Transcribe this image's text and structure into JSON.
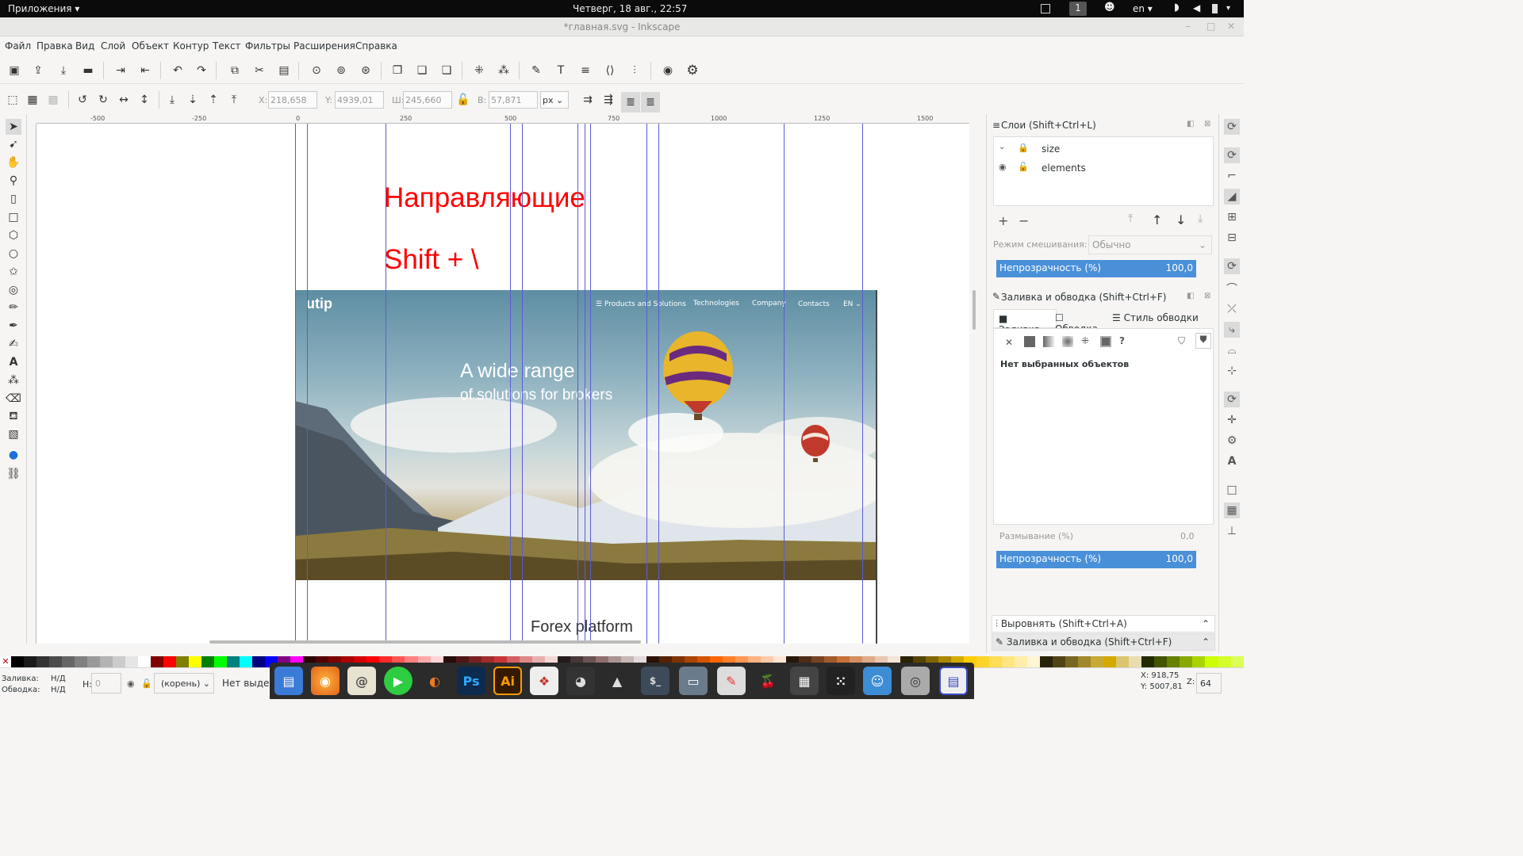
{
  "topbar": {
    "apps_menu": "Приложения ▾",
    "clock": "Четверг, 18 авг., 22:57",
    "workspace": "1",
    "lang": "en ▾"
  },
  "window": {
    "title": "*главная.svg - Inkscape"
  },
  "menu": [
    "Файл",
    "Правка",
    "Вид",
    "Слой",
    "Объект",
    "Контур",
    "Текст",
    "Фильтры",
    "Расширения",
    "Справка"
  ],
  "toolcontrols": {
    "x_label": "X:",
    "x_value": "218,658",
    "y_label": "Y:",
    "y_value": "4939,01",
    "w_label": "Ш:",
    "w_value": "245,660",
    "h_label": "В:",
    "h_value": "57,871",
    "unit": "px"
  },
  "ruler": {
    "ticks": [
      "-500",
      "-250",
      "0",
      "250",
      "500",
      "750",
      "1000",
      "1250",
      "1500"
    ]
  },
  "canvas": {
    "heading": "Направляющие",
    "shortcut": "Shift + \\",
    "hero": {
      "logo": "utip",
      "nav": [
        "☰ Products and Solutions",
        "Technologies",
        "Company",
        "Contacts",
        "EN ⌄"
      ],
      "headline": "A wide range",
      "subline": "of solutions for brokers"
    },
    "below": "Forex platform"
  },
  "layers_panel": {
    "title": "Слои (Shift+Ctrl+L)",
    "layers": [
      {
        "name": "size"
      },
      {
        "name": "elements"
      }
    ],
    "blend_label": "Режим смешивания:",
    "blend_value": "Обычно",
    "opacity_label": "Непрозрачность (%)",
    "opacity_value": "100,0"
  },
  "fill_panel": {
    "title": "Заливка и обводка (Shift+Ctrl+F)",
    "tabs": [
      "Заливка",
      "Обводка",
      "Стиль обводки"
    ],
    "empty": "Нет выбранных объектов",
    "blur_label": "Размывание (%)",
    "blur_value": "0,0",
    "opacity_label": "Непрозрачность (%)",
    "opacity_value": "100,0"
  },
  "collapsed_panels": [
    "Выровнять (Shift+Ctrl+A)",
    "Заливка и обводка (Shift+Ctrl+F)"
  ],
  "status": {
    "fill_label": "Заливка:",
    "fill_value": "Н/Д",
    "stroke_label": "Обводка:",
    "stroke_value": "Н/Д",
    "h_label": "Н:",
    "h_value": "0",
    "layer": "(корень)",
    "message": "Нет выделе",
    "x": "X:  918,75",
    "y": "Y: 5007,81",
    "zoom_label": "Z:",
    "zoom": "64"
  },
  "palette": [
    "#000000",
    "#1a1a1a",
    "#333333",
    "#4d4d4d",
    "#666666",
    "#808080",
    "#999999",
    "#b3b3b3",
    "#cccccc",
    "#e6e6e6",
    "#ffffff",
    "#800000",
    "#ff0000",
    "#808000",
    "#ffff00",
    "#008000",
    "#00ff00",
    "#008080",
    "#00ffff",
    "#000080",
    "#0000ff",
    "#800080",
    "#ff00ff",
    "#2b0000",
    "#550000",
    "#800000",
    "#aa0000",
    "#d40000",
    "#ff0000",
    "#ff2a2a",
    "#ff5555",
    "#ff8080",
    "#ffaaaa",
    "#ffd5d5",
    "#280b0b",
    "#501616",
    "#782121",
    "#a02c2c",
    "#c83737",
    "#d35f5f",
    "#de8787",
    "#e9afaf",
    "#f4d7d7",
    "#241c1c",
    "#483737",
    "#6c5353",
    "#916f6f",
    "#ac9393",
    "#c8b7b7",
    "#e3dbdb",
    "#2b1100",
    "#552200",
    "#803300",
    "#aa4400",
    "#d45500",
    "#ff6600",
    "#ff7f2a",
    "#ff9955",
    "#ffb380",
    "#ffccaa",
    "#ffe6d5",
    "#28170b",
    "#502d16",
    "#784421",
    "#a05a2c",
    "#c87137",
    "#d38d5f",
    "#deaa87",
    "#e9c6af",
    "#f4e3d7",
    "#2b2200",
    "#554400",
    "#806600",
    "#aa8800",
    "#d4aa00",
    "#ffcc00",
    "#ffd42a",
    "#ffdd55",
    "#ffe680",
    "#ffeeaa",
    "#fff6d5",
    "#28220b",
    "#504416",
    "#786721",
    "#a0892c",
    "#c8ab37",
    "#d4aa00",
    "#dbc66f",
    "#e9ddaf",
    "#222b00",
    "#445500",
    "#668000",
    "#88aa00",
    "#aad400",
    "#ccff00",
    "#d4ff2a",
    "#ddff55"
  ]
}
